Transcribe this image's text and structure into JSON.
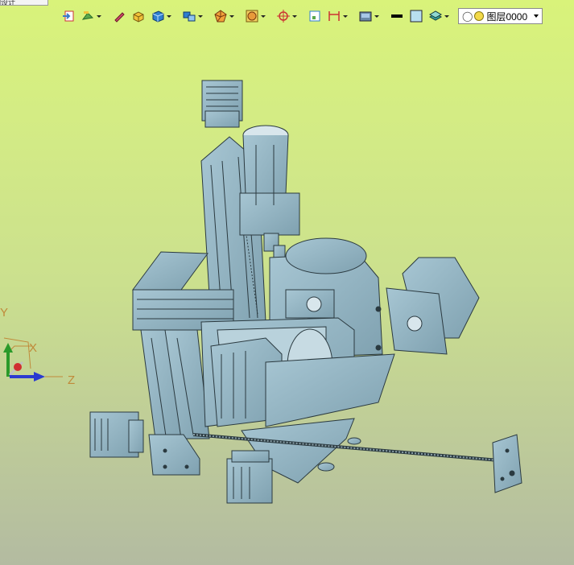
{
  "window": {
    "tab_label": "设计"
  },
  "toolbar": {
    "buttons": [
      {
        "name": "import-icon",
        "dropdown": false
      },
      {
        "name": "surface-icon",
        "dropdown": true
      },
      {
        "name": "pen-icon",
        "dropdown": false
      },
      {
        "name": "box-solid-icon",
        "dropdown": false
      },
      {
        "name": "cube-blue-icon",
        "dropdown": true
      },
      {
        "name": "assembly-icon",
        "dropdown": true
      },
      {
        "name": "polyhedron-icon",
        "dropdown": true
      },
      {
        "name": "render-sphere-icon",
        "dropdown": true
      },
      {
        "name": "crosshair-icon",
        "dropdown": true
      },
      {
        "name": "frame-icon",
        "dropdown": false
      },
      {
        "name": "dimension-icon",
        "dropdown": true
      },
      {
        "name": "view-icon",
        "dropdown": true
      },
      {
        "name": "line-color-icon",
        "dropdown": false
      },
      {
        "name": "fill-color-icon",
        "dropdown": false
      },
      {
        "name": "layer-stack-icon",
        "dropdown": true
      }
    ],
    "layer_select": {
      "value": "图层0000"
    }
  },
  "triad": {
    "y_label": "Y",
    "x_label": "X",
    "z_label": "Z"
  },
  "colors": {
    "model": "#8fb3c3",
    "model_dark": "#5e7f8e",
    "edge": "#2b3a40"
  }
}
